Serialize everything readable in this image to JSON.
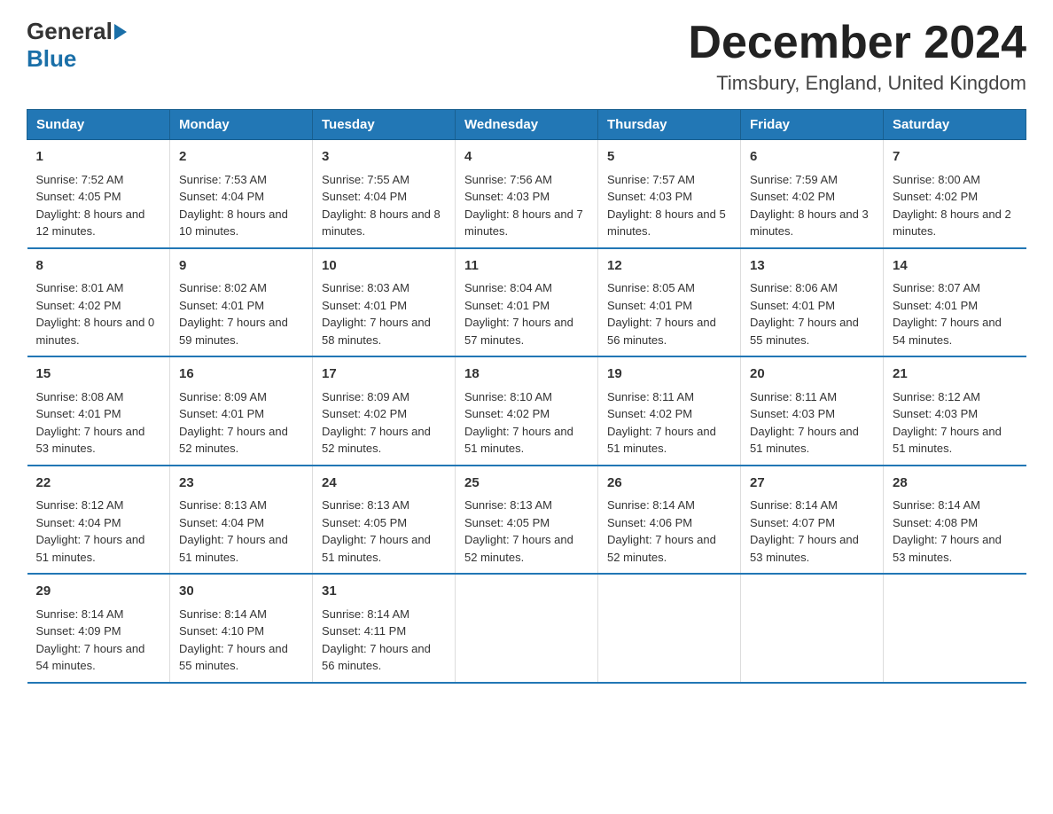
{
  "logo": {
    "general": "General",
    "blue": "Blue"
  },
  "header": {
    "month_year": "December 2024",
    "location": "Timsbury, England, United Kingdom"
  },
  "days_of_week": [
    "Sunday",
    "Monday",
    "Tuesday",
    "Wednesday",
    "Thursday",
    "Friday",
    "Saturday"
  ],
  "weeks": [
    [
      {
        "day": "1",
        "sunrise": "7:52 AM",
        "sunset": "4:05 PM",
        "daylight": "8 hours and 12 minutes."
      },
      {
        "day": "2",
        "sunrise": "7:53 AM",
        "sunset": "4:04 PM",
        "daylight": "8 hours and 10 minutes."
      },
      {
        "day": "3",
        "sunrise": "7:55 AM",
        "sunset": "4:04 PM",
        "daylight": "8 hours and 8 minutes."
      },
      {
        "day": "4",
        "sunrise": "7:56 AM",
        "sunset": "4:03 PM",
        "daylight": "8 hours and 7 minutes."
      },
      {
        "day": "5",
        "sunrise": "7:57 AM",
        "sunset": "4:03 PM",
        "daylight": "8 hours and 5 minutes."
      },
      {
        "day": "6",
        "sunrise": "7:59 AM",
        "sunset": "4:02 PM",
        "daylight": "8 hours and 3 minutes."
      },
      {
        "day": "7",
        "sunrise": "8:00 AM",
        "sunset": "4:02 PM",
        "daylight": "8 hours and 2 minutes."
      }
    ],
    [
      {
        "day": "8",
        "sunrise": "8:01 AM",
        "sunset": "4:02 PM",
        "daylight": "8 hours and 0 minutes."
      },
      {
        "day": "9",
        "sunrise": "8:02 AM",
        "sunset": "4:01 PM",
        "daylight": "7 hours and 59 minutes."
      },
      {
        "day": "10",
        "sunrise": "8:03 AM",
        "sunset": "4:01 PM",
        "daylight": "7 hours and 58 minutes."
      },
      {
        "day": "11",
        "sunrise": "8:04 AM",
        "sunset": "4:01 PM",
        "daylight": "7 hours and 57 minutes."
      },
      {
        "day": "12",
        "sunrise": "8:05 AM",
        "sunset": "4:01 PM",
        "daylight": "7 hours and 56 minutes."
      },
      {
        "day": "13",
        "sunrise": "8:06 AM",
        "sunset": "4:01 PM",
        "daylight": "7 hours and 55 minutes."
      },
      {
        "day": "14",
        "sunrise": "8:07 AM",
        "sunset": "4:01 PM",
        "daylight": "7 hours and 54 minutes."
      }
    ],
    [
      {
        "day": "15",
        "sunrise": "8:08 AM",
        "sunset": "4:01 PM",
        "daylight": "7 hours and 53 minutes."
      },
      {
        "day": "16",
        "sunrise": "8:09 AM",
        "sunset": "4:01 PM",
        "daylight": "7 hours and 52 minutes."
      },
      {
        "day": "17",
        "sunrise": "8:09 AM",
        "sunset": "4:02 PM",
        "daylight": "7 hours and 52 minutes."
      },
      {
        "day": "18",
        "sunrise": "8:10 AM",
        "sunset": "4:02 PM",
        "daylight": "7 hours and 51 minutes."
      },
      {
        "day": "19",
        "sunrise": "8:11 AM",
        "sunset": "4:02 PM",
        "daylight": "7 hours and 51 minutes."
      },
      {
        "day": "20",
        "sunrise": "8:11 AM",
        "sunset": "4:03 PM",
        "daylight": "7 hours and 51 minutes."
      },
      {
        "day": "21",
        "sunrise": "8:12 AM",
        "sunset": "4:03 PM",
        "daylight": "7 hours and 51 minutes."
      }
    ],
    [
      {
        "day": "22",
        "sunrise": "8:12 AM",
        "sunset": "4:04 PM",
        "daylight": "7 hours and 51 minutes."
      },
      {
        "day": "23",
        "sunrise": "8:13 AM",
        "sunset": "4:04 PM",
        "daylight": "7 hours and 51 minutes."
      },
      {
        "day": "24",
        "sunrise": "8:13 AM",
        "sunset": "4:05 PM",
        "daylight": "7 hours and 51 minutes."
      },
      {
        "day": "25",
        "sunrise": "8:13 AM",
        "sunset": "4:05 PM",
        "daylight": "7 hours and 52 minutes."
      },
      {
        "day": "26",
        "sunrise": "8:14 AM",
        "sunset": "4:06 PM",
        "daylight": "7 hours and 52 minutes."
      },
      {
        "day": "27",
        "sunrise": "8:14 AM",
        "sunset": "4:07 PM",
        "daylight": "7 hours and 53 minutes."
      },
      {
        "day": "28",
        "sunrise": "8:14 AM",
        "sunset": "4:08 PM",
        "daylight": "7 hours and 53 minutes."
      }
    ],
    [
      {
        "day": "29",
        "sunrise": "8:14 AM",
        "sunset": "4:09 PM",
        "daylight": "7 hours and 54 minutes."
      },
      {
        "day": "30",
        "sunrise": "8:14 AM",
        "sunset": "4:10 PM",
        "daylight": "7 hours and 55 minutes."
      },
      {
        "day": "31",
        "sunrise": "8:14 AM",
        "sunset": "4:11 PM",
        "daylight": "7 hours and 56 minutes."
      },
      null,
      null,
      null,
      null
    ]
  ]
}
